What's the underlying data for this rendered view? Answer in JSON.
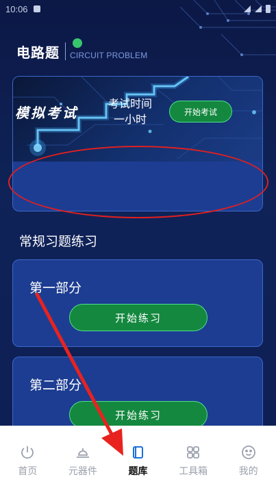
{
  "status_bar": {
    "time": "10:06"
  },
  "header": {
    "logo_cn": "电路题",
    "logo_en": "CIRCUIT PROBLEM"
  },
  "exam": {
    "title": "模拟考试",
    "time_line1": "考试时间",
    "time_line2": "一小时",
    "start_label": "开始考试"
  },
  "practice": {
    "section_title": "常规习题练习",
    "parts": [
      {
        "title": "第一部分",
        "button": "开始练习"
      },
      {
        "title": "第二部分",
        "button": "开始练习"
      }
    ]
  },
  "nav": {
    "items": [
      {
        "label": "首页",
        "icon": "power-icon"
      },
      {
        "label": "元器件",
        "icon": "component-icon"
      },
      {
        "label": "题库",
        "icon": "book-icon",
        "active": true
      },
      {
        "label": "工具箱",
        "icon": "grid-icon"
      },
      {
        "label": "我的",
        "icon": "face-icon"
      }
    ]
  },
  "colors": {
    "background": "#0d1a4a",
    "card": "#1d3d92",
    "accent_green": "#14883f",
    "annotation_red": "#e02020",
    "nav_active": "#1a6fd8"
  }
}
